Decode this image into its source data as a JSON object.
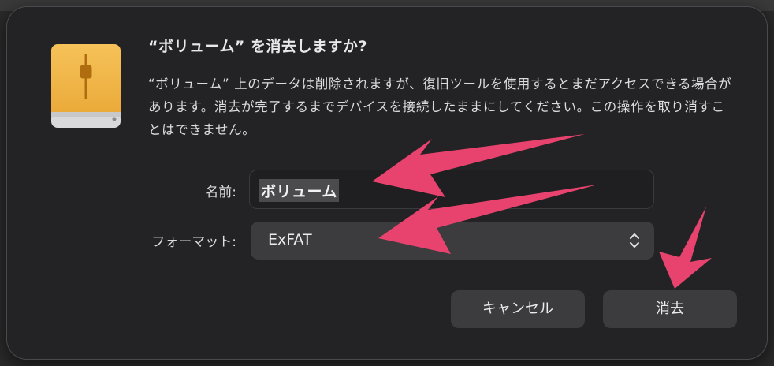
{
  "dialog": {
    "title": "“ボリューム” を消去しますか?",
    "message": "“ボリューム” 上のデータは削除されますが、復旧ツールを使用するとまだアクセスできる場合があります。消去が完了するまでデバイスを接続したままにしてください。この操作を取り消すことはできません。",
    "icon": "external-drive-icon",
    "name_label": "名前:",
    "name_value": "ボリューム",
    "format_label": "フォーマット:",
    "format_value": "ExFAT",
    "cancel_label": "キャンセル",
    "erase_label": "消去"
  },
  "colors": {
    "dialog_bg": "#232325",
    "drive_orange": "#f2b54a",
    "arrow_pink": "#e8436f",
    "button_bg": "#3c3c3e"
  }
}
